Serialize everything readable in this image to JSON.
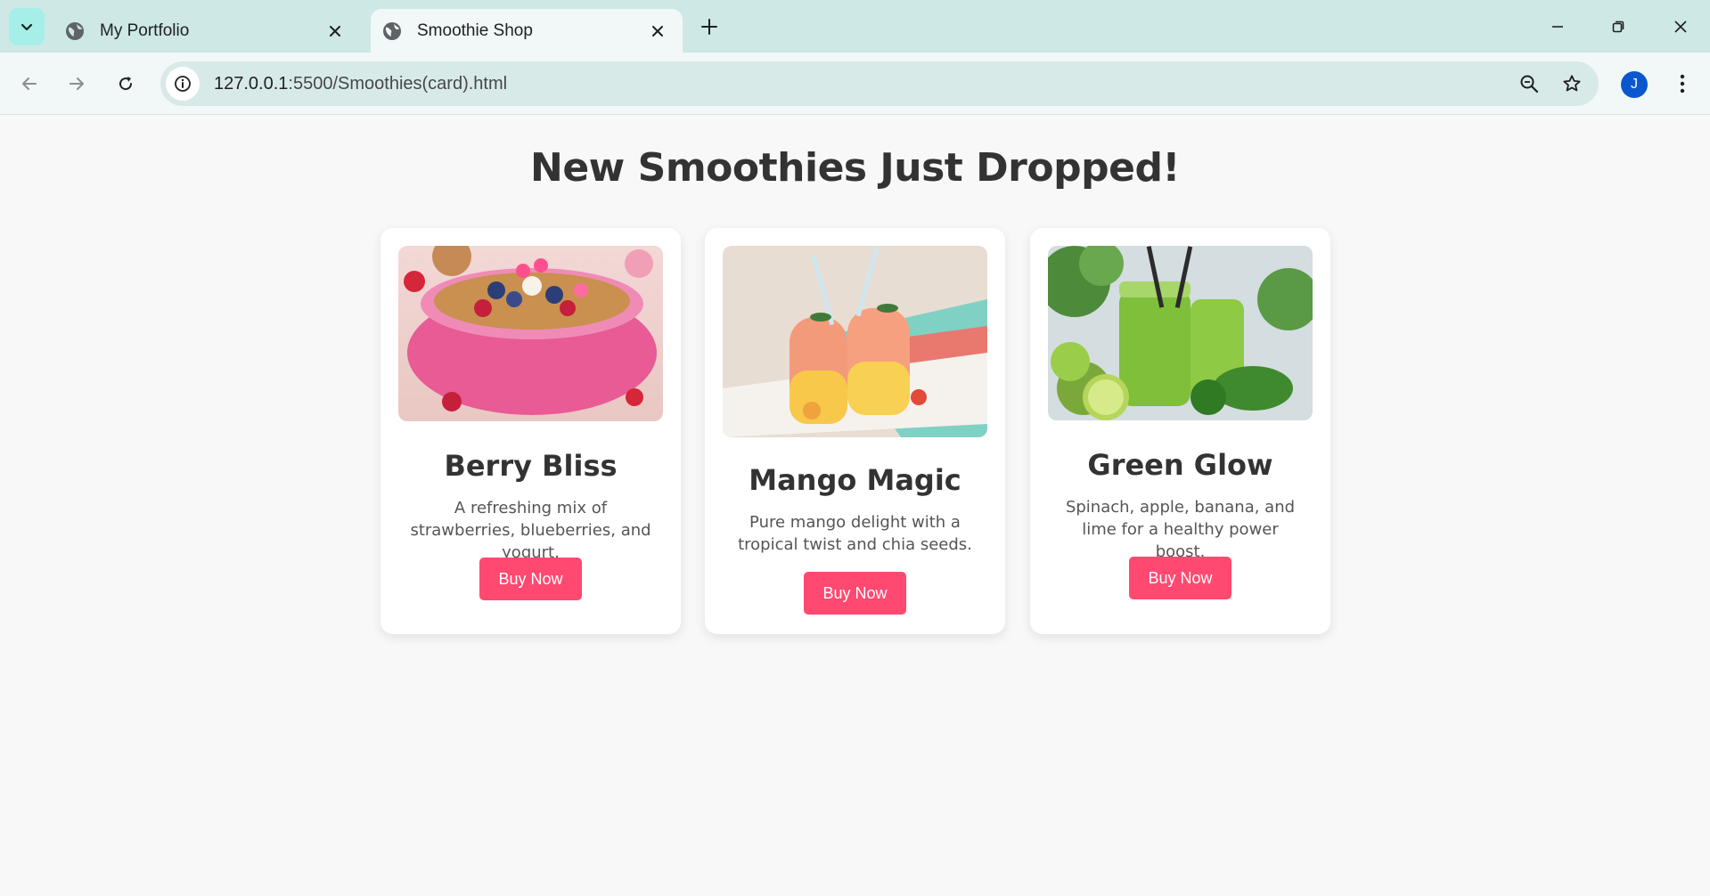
{
  "browser": {
    "tabs": [
      {
        "title": "My Portfolio",
        "active": false
      },
      {
        "title": "Smoothie Shop",
        "active": true
      }
    ],
    "url_host": "127.0.0.1",
    "url_path": ":5500/Smoothies(card).html",
    "profile_initial": "J"
  },
  "page": {
    "heading": "New Smoothies Just Dropped!",
    "cards": [
      {
        "name": "Berry Bliss",
        "description": "A refreshing mix of strawberries, blueberries, and yogurt.",
        "button": "Buy Now"
      },
      {
        "name": "Mango Magic",
        "description": "Pure mango delight with a tropical twist and chia seeds.",
        "button": "Buy Now"
      },
      {
        "name": "Green Glow",
        "description": "Spinach, apple, banana, and lime for a healthy power boost.",
        "button": "Buy Now"
      }
    ]
  },
  "colors": {
    "accent": "#ff4971",
    "tabstrip": "#cde8e5",
    "page_bg": "#f8f8f8",
    "heading": "#333333"
  }
}
